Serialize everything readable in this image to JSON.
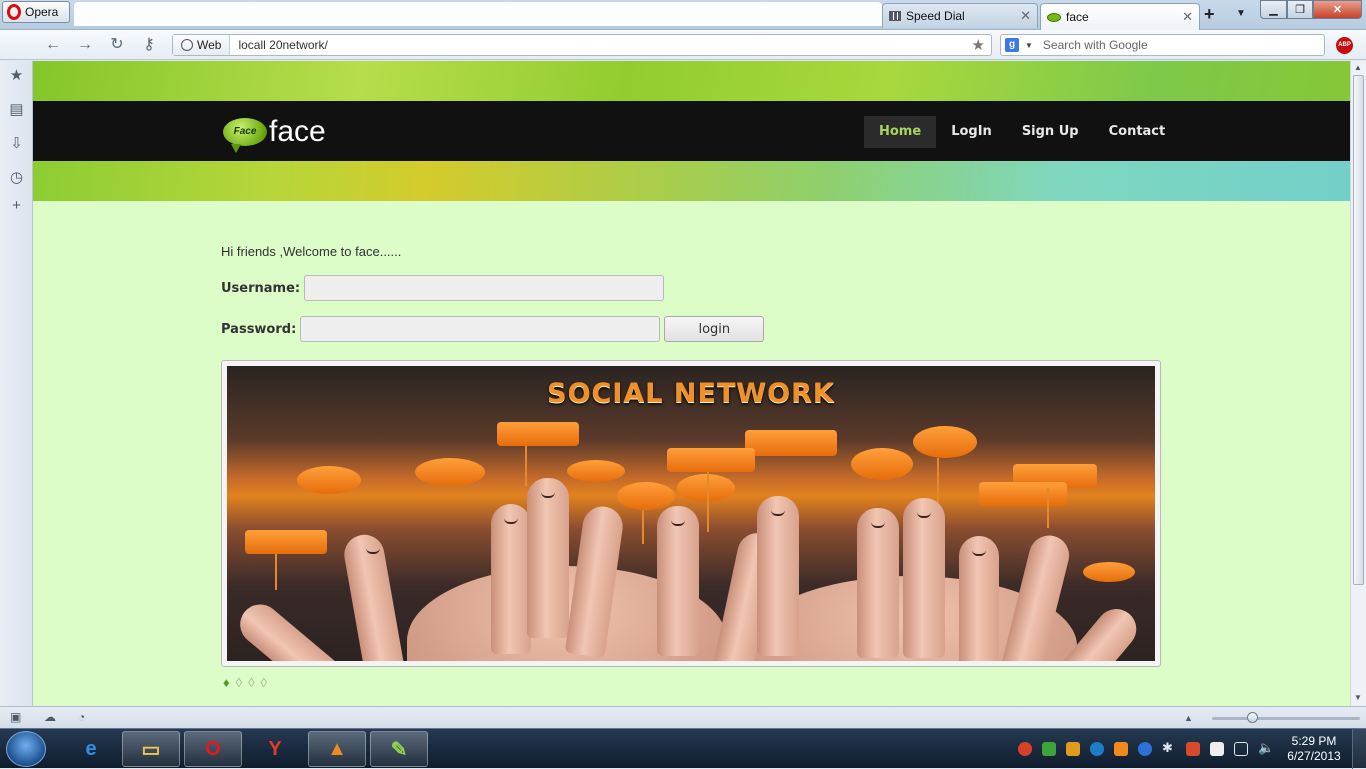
{
  "browser": {
    "menu_label": "Opera",
    "tabs": [
      {
        "label": "Speed Dial",
        "active": false
      },
      {
        "label": "face",
        "active": true
      }
    ],
    "address": {
      "scheme_label": "Web",
      "url": "locall                                                         20network/"
    },
    "search_placeholder": "Search with Google",
    "search_engine_letter": "g",
    "abp_label": "ABP"
  },
  "site": {
    "logo_badge": "Face",
    "logo_text": "face",
    "nav": [
      "Home",
      "LogIn",
      "Sign Up",
      "Contact"
    ],
    "welcome": "Hi friends ,Welcome to face......",
    "username_label": "Username:",
    "password_label": "Password:",
    "username_value": "",
    "password_value": "",
    "login_button": "login",
    "slide_title": "SOCIAL NETWORK",
    "slide_count": 4,
    "active_slide": 1
  },
  "taskbar": {
    "time": "5:29 PM",
    "date": "6/27/2013",
    "apps": [
      "internet-explorer",
      "windows-explorer",
      "opera",
      "yandex-browser",
      "vlc-player",
      "notepad-plus-plus"
    ]
  },
  "colors": {
    "page_bg": "#dcfcc8",
    "nav_bg": "#111111",
    "nav_active": "#a7d65b",
    "accent_orange": "#f0902a"
  }
}
